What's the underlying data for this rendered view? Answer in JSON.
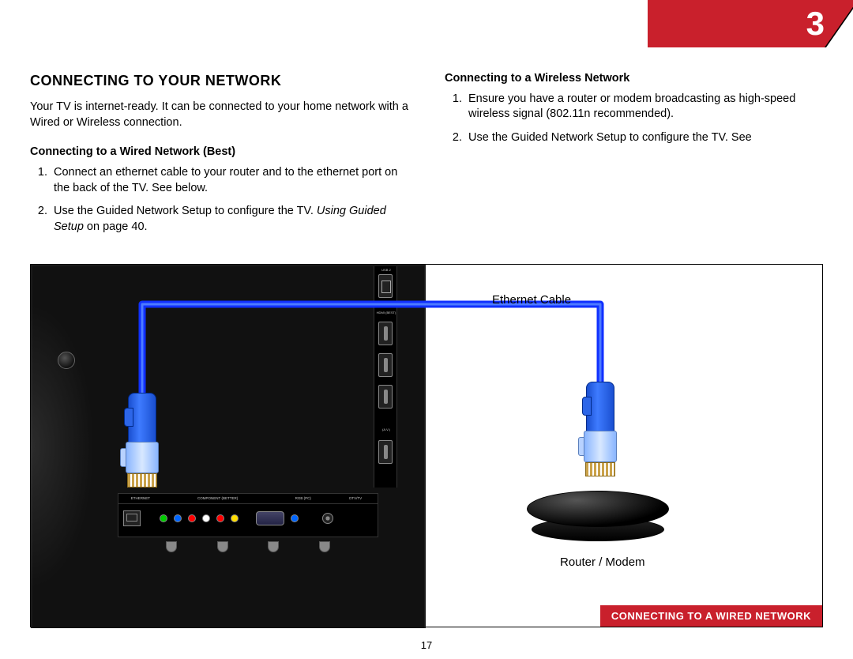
{
  "chapter_number": "3",
  "page_number": "17",
  "section_title": "CONNECTING TO YOUR NETWORK",
  "intro": "Your TV is internet-ready. It can be connected to your home network with a Wired or Wireless connection.",
  "wired": {
    "heading": "Connecting to a Wired Network (Best)",
    "step1": "Connect an ethernet cable to your router and to the ethernet port on the back of the TV. See below.",
    "step2_a": "Use the Guided Network Setup to configure the TV. ",
    "step2_b": "Using Guided Setup",
    "step2_c": " on page 40."
  },
  "wireless": {
    "heading": "Connecting to a Wireless Network",
    "step1": "Ensure you have a router or modem broadcasting as high-speed wireless signal (802.11n recommended).",
    "step2": "Use the Guided Network Setup to configure the TV. See"
  },
  "diagram": {
    "ethernet_label": "Ethernet Cable",
    "router_label": "Router / Modem",
    "caption": "CONNECTING TO A WIRED NETWORK",
    "strip": {
      "ethernet": "ETHERNET",
      "component": "COMPONENT (BETTER)",
      "rgb": "RGB (PC)",
      "dtv": "DTV/TV"
    },
    "side": {
      "usb": "USB 2",
      "hdmi": "HDMI (BEST)",
      "av": "(A.V.)"
    }
  }
}
